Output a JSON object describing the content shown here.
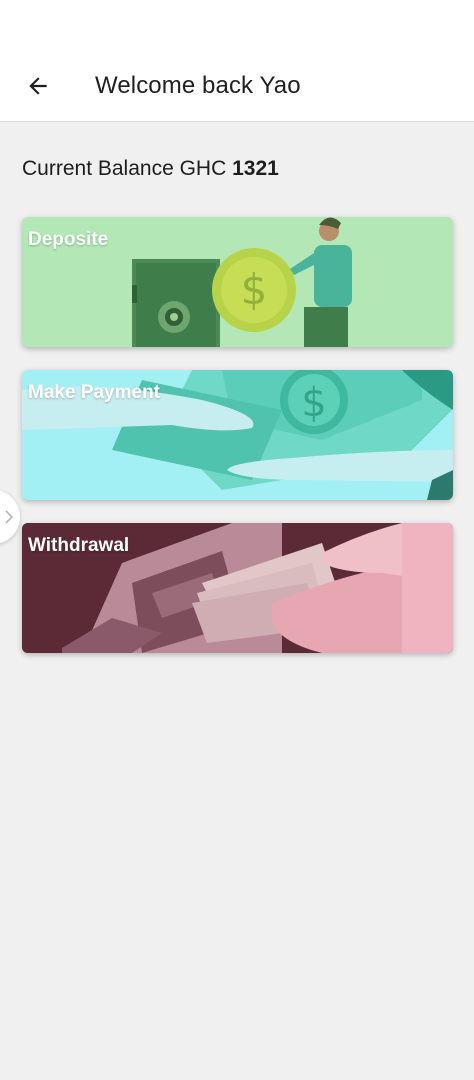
{
  "header": {
    "title": "Welcome back Yao",
    "back_icon": "arrow-left-icon"
  },
  "balance": {
    "label": "Current Balance GHC",
    "amount": "1321"
  },
  "cards": [
    {
      "label": "Deposite",
      "image": "safe-and-coin-illustration"
    },
    {
      "label": "Make Payment",
      "image": "money-handoff-illustration"
    },
    {
      "label": "Withdrawal",
      "image": "atm-cash-photo"
    }
  ],
  "colors": {
    "deposit_bg": "#b3e8b6",
    "payment_bg": "#a3f0f4",
    "withdraw_bg": "#6a3142",
    "page_bg": "#f0f0f0"
  }
}
